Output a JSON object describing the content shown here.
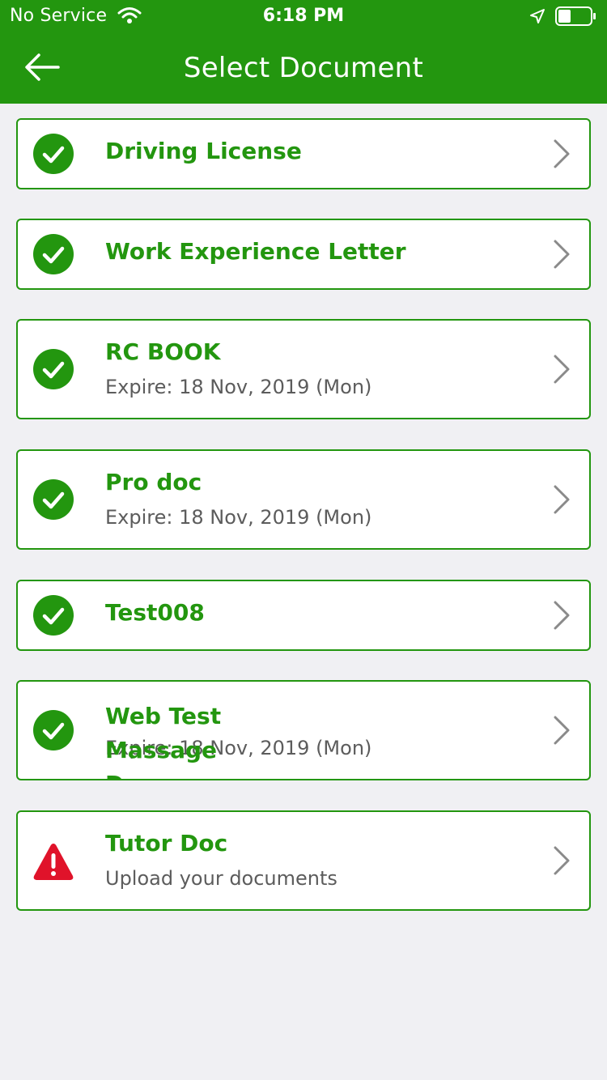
{
  "status_bar": {
    "carrier": "No Service",
    "time": "6:18 PM"
  },
  "header": {
    "title": "Select Document"
  },
  "colors": {
    "brand_green": "#23960f",
    "warning_red": "#e0132a"
  },
  "documents": [
    {
      "title": "Driving License",
      "subtitle": "",
      "status_icon": "check-circle-icon"
    },
    {
      "title": "Work Experience Letter",
      "subtitle": "",
      "status_icon": "check-circle-icon"
    },
    {
      "title": "RC BOOK",
      "subtitle": "Expire: 18 Nov, 2019 (Mon)",
      "status_icon": "check-circle-icon"
    },
    {
      "title": "Pro doc",
      "subtitle": "Expire: 18 Nov, 2019 (Mon)",
      "status_icon": "check-circle-icon"
    },
    {
      "title": "Test008",
      "subtitle": "",
      "status_icon": "check-circle-icon"
    },
    {
      "title": "Web Test Massage Doc",
      "subtitle": "Expire: 18 Nov, 2019 (Mon)",
      "status_icon": "check-circle-icon"
    },
    {
      "title": "Tutor Doc",
      "subtitle": "Upload your documents",
      "status_icon": "warning-icon"
    }
  ]
}
